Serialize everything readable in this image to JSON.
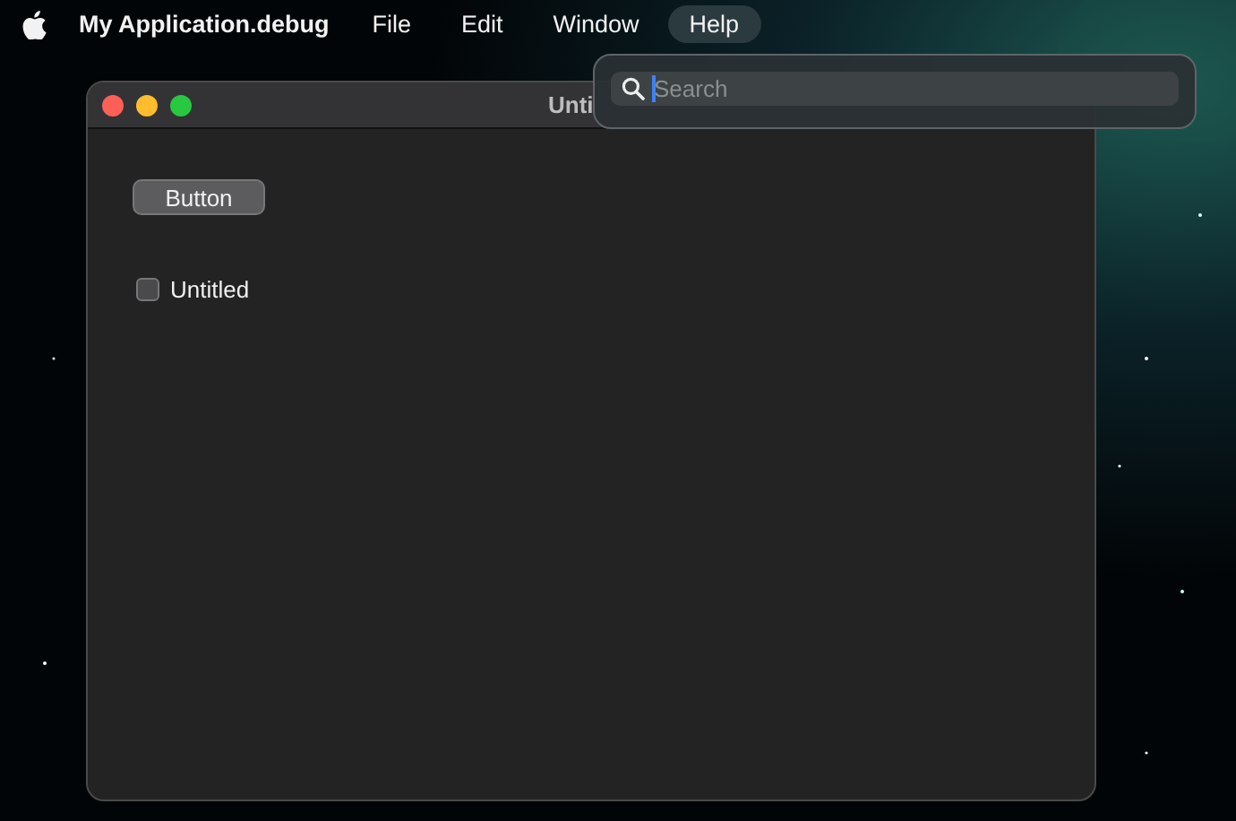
{
  "menu_bar": {
    "app_name": "My Application.debug",
    "menus": [
      {
        "label": "File",
        "selected": false
      },
      {
        "label": "Edit",
        "selected": false
      },
      {
        "label": "Window",
        "selected": false
      },
      {
        "label": "Help",
        "selected": true
      }
    ]
  },
  "help_popup": {
    "search": {
      "placeholder": "Search"
    }
  },
  "window": {
    "title": "Unti",
    "button": {
      "label": "Button"
    },
    "checkbox": {
      "label": "Untitled",
      "checked": false
    }
  }
}
